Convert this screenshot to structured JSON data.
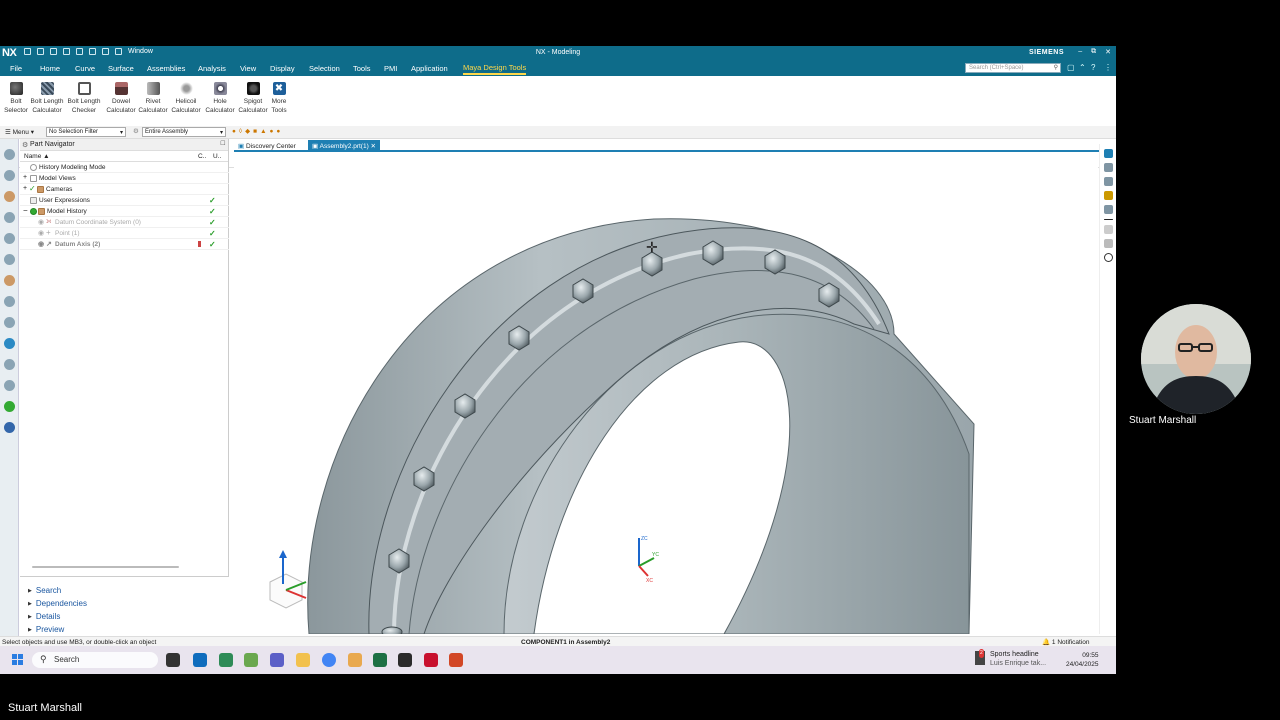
{
  "app": {
    "logo": "NX",
    "title": "NX - Modeling",
    "brand": "SIEMENS",
    "quick_access_window": "Window",
    "window_controls": [
      "–",
      "⧉",
      "✕"
    ]
  },
  "menu": {
    "items": [
      "File",
      "Home",
      "Curve",
      "Surface",
      "Assemblies",
      "Analysis",
      "View",
      "Display",
      "Selection",
      "Tools",
      "PMI",
      "Application",
      "Maya Design Tools"
    ],
    "active": "Maya Design Tools",
    "search_placeholder": "Search (Ctrl+Space)"
  },
  "ribbon": {
    "tools": [
      {
        "line1": "Bolt",
        "line2": "Selector",
        "icon": "bolt-icon"
      },
      {
        "line1": "Bolt Length",
        "line2": "Calculator",
        "icon": "bolt-pattern-icon"
      },
      {
        "line1": "Bolt Length",
        "line2": "Checker",
        "icon": "checker-icon"
      },
      {
        "line1": "Dowel",
        "line2": "Calculator",
        "icon": "dowel-icon"
      },
      {
        "line1": "Rivet",
        "line2": "Calculator",
        "icon": "rivet-icon"
      },
      {
        "line1": "Helicoil",
        "line2": "Calculator",
        "icon": "helicoil-icon"
      },
      {
        "line1": "Hole",
        "line2": "Calculator",
        "icon": "hole-icon"
      },
      {
        "line1": "Spigot",
        "line2": "Calculator",
        "icon": "spigot-icon"
      },
      {
        "line1": "More",
        "line2": "Tools",
        "icon": "more-tools-icon"
      }
    ]
  },
  "toolbar2": {
    "menu_label": "Menu",
    "selection_filter": "No Selection Filter",
    "scope": "Entire Assembly"
  },
  "part_navigator": {
    "title": "Part Navigator",
    "col_name": "Name",
    "col_c": "C..",
    "col_u": "U..",
    "rows": [
      {
        "label": "History Modeling Mode",
        "check": ""
      },
      {
        "label": "Model Views",
        "check": ""
      },
      {
        "label": "Cameras",
        "check": ""
      },
      {
        "label": "User Expressions",
        "check": "✓"
      },
      {
        "label": "Model History",
        "check": "✓"
      },
      {
        "label": "Datum Coordinate System (0)",
        "check": "✓"
      },
      {
        "label": "Point (1)",
        "check": "✓"
      },
      {
        "label": "Datum Axis (2)",
        "check": "✓"
      }
    ],
    "panels": [
      "Search",
      "Dependencies",
      "Details",
      "Preview"
    ]
  },
  "tabs": [
    {
      "label": "Discovery Center"
    },
    {
      "label": "Assembly2.prt(1)"
    }
  ],
  "viewport": {
    "triad": {
      "zc": "ZC",
      "yc": "YC",
      "xc": "XC"
    }
  },
  "status": {
    "left": "Select objects and use MB3, or double-click an object",
    "center": "COMPONENT1 in Assembly2",
    "right": "1 Notification"
  },
  "taskbar": {
    "search": "Search",
    "news_badge": "2",
    "news_title": "Sports headline",
    "news_sub": "Luis Enrique tak...",
    "time": "09:55",
    "date": "24/04/2025"
  },
  "presenter": {
    "cam_name": "Stuart Marshall",
    "bottom_name": "Stuart Marshall"
  },
  "colors": {
    "titlebar": "#0e6c8a",
    "active_menu": "#ffd84a",
    "part_grey": "#a3adb2"
  }
}
